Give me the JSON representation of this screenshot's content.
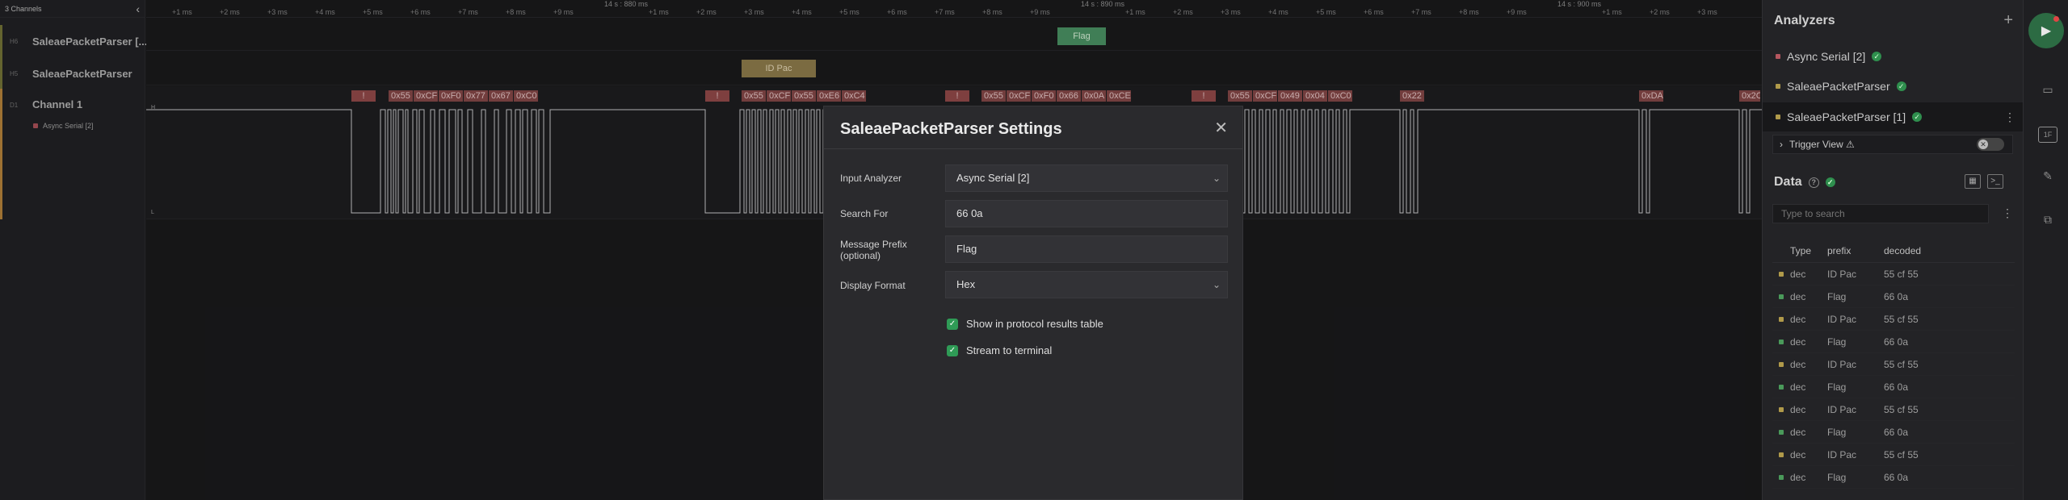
{
  "channels_panel": {
    "header": "3 Channels",
    "rows": [
      {
        "num": "H6",
        "name": "SaleaePacketParser [...",
        "color": "#7a7a3a"
      },
      {
        "num": "H5",
        "name": "SaleaePacketParser",
        "color": "#7a7a3a"
      },
      {
        "num": "D1",
        "name": "Channel 1",
        "color": "#c08a3e"
      }
    ],
    "sub_analyzer": "Async Serial [2]"
  },
  "timeline": {
    "ticks": [
      "+1 ms",
      "+2 ms",
      "+3 ms",
      "+4 ms",
      "+5 ms",
      "+6 ms",
      "+7 ms",
      "+8 ms",
      "+9 ms",
      "+1 ms",
      "+2 ms",
      "+3 ms",
      "+4 ms",
      "+5 ms",
      "+6 ms",
      "+7 ms",
      "+8 ms",
      "+9 ms",
      "+1 ms",
      "+2 ms",
      "+3 ms",
      "+4 ms",
      "+5 ms",
      "+6 ms",
      "+7 ms",
      "+8 ms",
      "+9 ms",
      "+1 ms",
      "+2 ms",
      "+3 ms"
    ],
    "major": [
      "14 s : 880 ms",
      "14 s : 890 ms",
      "14 s : 900 ms"
    ]
  },
  "waveform": {
    "level_high": "H",
    "level_low": "L",
    "flag_label": "Flag",
    "id_pac_label": "ID Pac",
    "bang": "!",
    "group1": [
      "0x55",
      "0xCF",
      "0xF0",
      "0x77",
      "0x67",
      "0xC0"
    ],
    "group2": [
      "0x55",
      "0xCF",
      "0x55",
      "0xE6",
      "0xC4"
    ],
    "group3": [
      "0x55",
      "0xCF",
      "0xF0",
      "0x66",
      "0x0A",
      "0xCE"
    ],
    "group4": [
      "0x55",
      "0xCF",
      "0x49",
      "0x04",
      "0xC0"
    ],
    "extra": [
      "0x22",
      "0xDA",
      "0x2C"
    ]
  },
  "modal": {
    "title": "SaleaePacketParser Settings",
    "close": "✕",
    "fields": {
      "input_analyzer_label": "Input Analyzer",
      "input_analyzer_value": "Async Serial [2]",
      "search_for_label": "Search For",
      "search_for_value": "66 0a",
      "prefix_label_1": "Message Prefix",
      "prefix_label_2": "(optional)",
      "prefix_value": "Flag",
      "display_format_label": "Display Format",
      "display_format_value": "Hex"
    },
    "checkbox1": "Show in protocol results table",
    "checkbox2": "Stream to terminal"
  },
  "analyzers": {
    "title": "Analyzers",
    "add": "+",
    "items": [
      {
        "name": "Async Serial [2]",
        "color": "#b5565f"
      },
      {
        "name": "SaleaePacketParser",
        "color": "#b09a4a"
      },
      {
        "name": "SaleaePacketParser [1]",
        "color": "#b09a4a"
      }
    ],
    "trigger_view": "Trigger View ⚠"
  },
  "data": {
    "title": "Data",
    "search_placeholder": "Type to search",
    "columns": [
      "Type",
      "prefix",
      "decoded"
    ],
    "rows": [
      {
        "type": "dec",
        "prefix": "ID Pac",
        "decoded": "55 cf 55",
        "color": "#b09a4a"
      },
      {
        "type": "dec",
        "prefix": "Flag",
        "decoded": "66 0a",
        "color": "#4a9a5a"
      },
      {
        "type": "dec",
        "prefix": "ID Pac",
        "decoded": "55 cf 55",
        "color": "#b09a4a"
      },
      {
        "type": "dec",
        "prefix": "Flag",
        "decoded": "66 0a",
        "color": "#4a9a5a"
      },
      {
        "type": "dec",
        "prefix": "ID Pac",
        "decoded": "55 cf 55",
        "color": "#b09a4a"
      },
      {
        "type": "dec",
        "prefix": "Flag",
        "decoded": "66 0a",
        "color": "#4a9a5a"
      },
      {
        "type": "dec",
        "prefix": "ID Pac",
        "decoded": "55 cf 55",
        "color": "#b09a4a"
      },
      {
        "type": "dec",
        "prefix": "Flag",
        "decoded": "66 0a",
        "color": "#4a9a5a"
      },
      {
        "type": "dec",
        "prefix": "ID Pac",
        "decoded": "55 cf 55",
        "color": "#b09a4a"
      },
      {
        "type": "dec",
        "prefix": "Flag",
        "decoded": "66 0a",
        "color": "#4a9a5a"
      }
    ]
  },
  "sidebar": {
    "icons": [
      "play-icon",
      "device-icon",
      "analyzer-icon",
      "measure-icon",
      "extensions-icon"
    ],
    "analyzer_icon_text": "1F"
  }
}
